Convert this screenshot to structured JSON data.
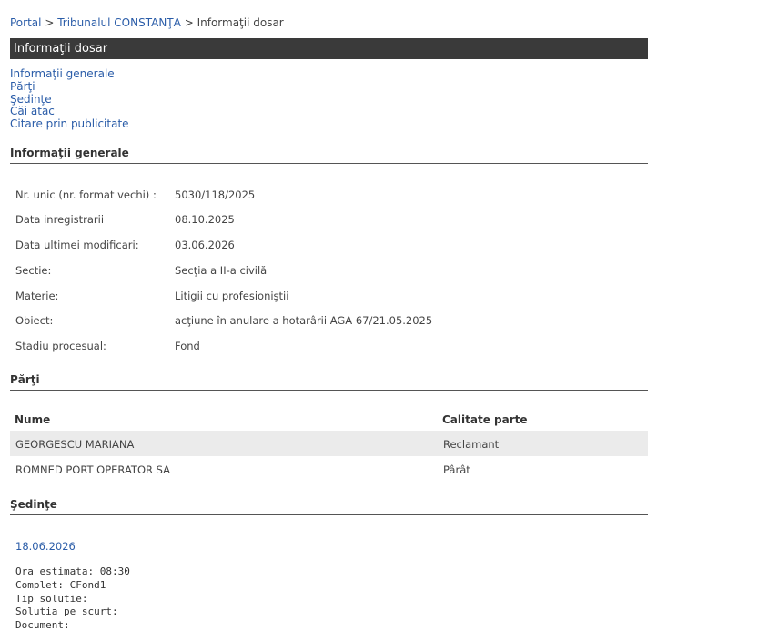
{
  "breadcrumb": {
    "portal": "Portal",
    "sep1": ">",
    "court": "Tribunalul CONSTANŢA",
    "sep2": ">",
    "current": "Informaţii dosar"
  },
  "title_bar": "Informaţii dosar",
  "nav_links": [
    "Informaţii generale",
    "Părţi",
    "Şedinţe",
    "Căi atac",
    "Citare prin publicitate"
  ],
  "general": {
    "heading": "Informaţii generale",
    "rows": [
      {
        "label": "Nr. unic (nr. format vechi) :",
        "value": "5030/118/2025"
      },
      {
        "label": "Data inregistrarii",
        "value": "08.10.2025"
      },
      {
        "label": "Data ultimei modificari:",
        "value": "03.06.2026"
      },
      {
        "label": "Sectie:",
        "value": "Secţia a II-a civilă"
      },
      {
        "label": "Materie:",
        "value": "Litigii cu profesioniştii"
      },
      {
        "label": "Obiect:",
        "value": "acţiune în anulare a hotarârii AGA 67/21.05.2025"
      },
      {
        "label": "Stadiu procesual:",
        "value": "Fond"
      }
    ]
  },
  "parti": {
    "heading": "Părţi",
    "col_name": "Nume",
    "col_role": "Calitate parte",
    "rows": [
      {
        "name": "GEORGESCU MARIANA",
        "role": "Reclamant"
      },
      {
        "name": "ROMNED PORT OPERATOR SA",
        "role": "Pârât"
      }
    ]
  },
  "sedinte": {
    "heading": "Şedinţe",
    "date": "18.06.2026",
    "ora": "Ora estimata: 08:30",
    "complet": "Complet: CFond1",
    "tip": "Tip solutie:",
    "solutia": "Solutia pe scurt:",
    "document": "Document:"
  }
}
